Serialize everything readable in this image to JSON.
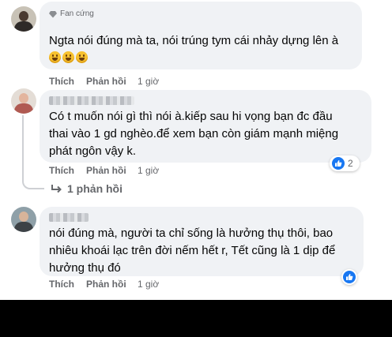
{
  "comments": [
    {
      "badge": "Fan cứng",
      "text_lines": [
        "Ngta nói đúng mà ta, nói trúng tym cái nhảy dựng lên à"
      ],
      "emoji": [
        "grinning-face-emoji",
        "grinning-face-emoji",
        "grinning-face-emoji"
      ],
      "actions": {
        "like": "Thích",
        "reply": "Phản hồi",
        "time": "1 giờ"
      }
    },
    {
      "text_lines": [
        "Có t muốn nói gì thì nói à.kiếp sau hi vọng bạn đc đầu",
        "thai vào 1 gd nghèo.để xem bạn còn giám mạnh miệng",
        "phát ngôn vậy k."
      ],
      "actions": {
        "like": "Thích",
        "reply": "Phản hồi",
        "time": "1 giờ"
      },
      "reaction": {
        "icon": "like-icon",
        "count": "2"
      },
      "replies_label": "1 phản hồi"
    },
    {
      "text_lines": [
        "nói đúng mà, người ta chỉ sống là hưởng thụ thôi, bao",
        "nhiêu khoái lạc trên đời nếm hết r, Tết cũng là 1 dịp để",
        "hưởng thụ đó"
      ],
      "actions": {
        "like": "Thích",
        "reply": "Phản hồi",
        "time": "1 giờ"
      },
      "reaction": {
        "icon": "like-icon"
      }
    }
  ],
  "colors": {
    "bubble": "#f0f2f5",
    "secondary_text": "#65676b",
    "like_blue": "#1877f2"
  }
}
